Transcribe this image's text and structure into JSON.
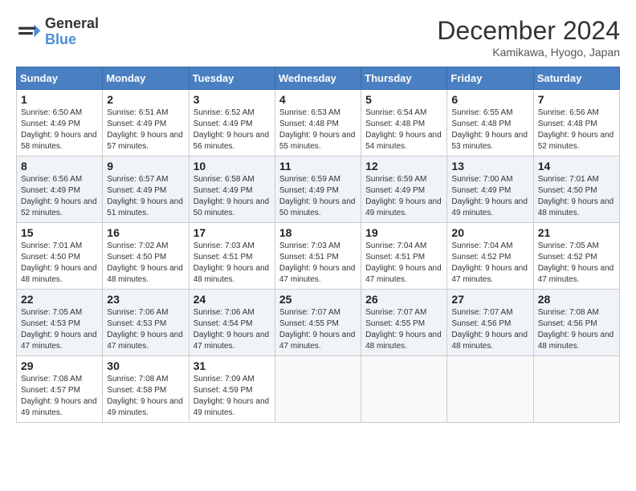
{
  "header": {
    "logo_line1": "General",
    "logo_line2": "Blue",
    "month": "December 2024",
    "location": "Kamikawa, Hyogo, Japan"
  },
  "weekdays": [
    "Sunday",
    "Monday",
    "Tuesday",
    "Wednesday",
    "Thursday",
    "Friday",
    "Saturday"
  ],
  "weeks": [
    [
      {
        "day": "1",
        "sunrise": "Sunrise: 6:50 AM",
        "sunset": "Sunset: 4:49 PM",
        "daylight": "Daylight: 9 hours and 58 minutes."
      },
      {
        "day": "2",
        "sunrise": "Sunrise: 6:51 AM",
        "sunset": "Sunset: 4:49 PM",
        "daylight": "Daylight: 9 hours and 57 minutes."
      },
      {
        "day": "3",
        "sunrise": "Sunrise: 6:52 AM",
        "sunset": "Sunset: 4:49 PM",
        "daylight": "Daylight: 9 hours and 56 minutes."
      },
      {
        "day": "4",
        "sunrise": "Sunrise: 6:53 AM",
        "sunset": "Sunset: 4:48 PM",
        "daylight": "Daylight: 9 hours and 55 minutes."
      },
      {
        "day": "5",
        "sunrise": "Sunrise: 6:54 AM",
        "sunset": "Sunset: 4:48 PM",
        "daylight": "Daylight: 9 hours and 54 minutes."
      },
      {
        "day": "6",
        "sunrise": "Sunrise: 6:55 AM",
        "sunset": "Sunset: 4:48 PM",
        "daylight": "Daylight: 9 hours and 53 minutes."
      },
      {
        "day": "7",
        "sunrise": "Sunrise: 6:56 AM",
        "sunset": "Sunset: 4:48 PM",
        "daylight": "Daylight: 9 hours and 52 minutes."
      }
    ],
    [
      {
        "day": "8",
        "sunrise": "Sunrise: 6:56 AM",
        "sunset": "Sunset: 4:49 PM",
        "daylight": "Daylight: 9 hours and 52 minutes."
      },
      {
        "day": "9",
        "sunrise": "Sunrise: 6:57 AM",
        "sunset": "Sunset: 4:49 PM",
        "daylight": "Daylight: 9 hours and 51 minutes."
      },
      {
        "day": "10",
        "sunrise": "Sunrise: 6:58 AM",
        "sunset": "Sunset: 4:49 PM",
        "daylight": "Daylight: 9 hours and 50 minutes."
      },
      {
        "day": "11",
        "sunrise": "Sunrise: 6:59 AM",
        "sunset": "Sunset: 4:49 PM",
        "daylight": "Daylight: 9 hours and 50 minutes."
      },
      {
        "day": "12",
        "sunrise": "Sunrise: 6:59 AM",
        "sunset": "Sunset: 4:49 PM",
        "daylight": "Daylight: 9 hours and 49 minutes."
      },
      {
        "day": "13",
        "sunrise": "Sunrise: 7:00 AM",
        "sunset": "Sunset: 4:49 PM",
        "daylight": "Daylight: 9 hours and 49 minutes."
      },
      {
        "day": "14",
        "sunrise": "Sunrise: 7:01 AM",
        "sunset": "Sunset: 4:50 PM",
        "daylight": "Daylight: 9 hours and 48 minutes."
      }
    ],
    [
      {
        "day": "15",
        "sunrise": "Sunrise: 7:01 AM",
        "sunset": "Sunset: 4:50 PM",
        "daylight": "Daylight: 9 hours and 48 minutes."
      },
      {
        "day": "16",
        "sunrise": "Sunrise: 7:02 AM",
        "sunset": "Sunset: 4:50 PM",
        "daylight": "Daylight: 9 hours and 48 minutes."
      },
      {
        "day": "17",
        "sunrise": "Sunrise: 7:03 AM",
        "sunset": "Sunset: 4:51 PM",
        "daylight": "Daylight: 9 hours and 48 minutes."
      },
      {
        "day": "18",
        "sunrise": "Sunrise: 7:03 AM",
        "sunset": "Sunset: 4:51 PM",
        "daylight": "Daylight: 9 hours and 47 minutes."
      },
      {
        "day": "19",
        "sunrise": "Sunrise: 7:04 AM",
        "sunset": "Sunset: 4:51 PM",
        "daylight": "Daylight: 9 hours and 47 minutes."
      },
      {
        "day": "20",
        "sunrise": "Sunrise: 7:04 AM",
        "sunset": "Sunset: 4:52 PM",
        "daylight": "Daylight: 9 hours and 47 minutes."
      },
      {
        "day": "21",
        "sunrise": "Sunrise: 7:05 AM",
        "sunset": "Sunset: 4:52 PM",
        "daylight": "Daylight: 9 hours and 47 minutes."
      }
    ],
    [
      {
        "day": "22",
        "sunrise": "Sunrise: 7:05 AM",
        "sunset": "Sunset: 4:53 PM",
        "daylight": "Daylight: 9 hours and 47 minutes."
      },
      {
        "day": "23",
        "sunrise": "Sunrise: 7:06 AM",
        "sunset": "Sunset: 4:53 PM",
        "daylight": "Daylight: 9 hours and 47 minutes."
      },
      {
        "day": "24",
        "sunrise": "Sunrise: 7:06 AM",
        "sunset": "Sunset: 4:54 PM",
        "daylight": "Daylight: 9 hours and 47 minutes."
      },
      {
        "day": "25",
        "sunrise": "Sunrise: 7:07 AM",
        "sunset": "Sunset: 4:55 PM",
        "daylight": "Daylight: 9 hours and 47 minutes."
      },
      {
        "day": "26",
        "sunrise": "Sunrise: 7:07 AM",
        "sunset": "Sunset: 4:55 PM",
        "daylight": "Daylight: 9 hours and 48 minutes."
      },
      {
        "day": "27",
        "sunrise": "Sunrise: 7:07 AM",
        "sunset": "Sunset: 4:56 PM",
        "daylight": "Daylight: 9 hours and 48 minutes."
      },
      {
        "day": "28",
        "sunrise": "Sunrise: 7:08 AM",
        "sunset": "Sunset: 4:56 PM",
        "daylight": "Daylight: 9 hours and 48 minutes."
      }
    ],
    [
      {
        "day": "29",
        "sunrise": "Sunrise: 7:08 AM",
        "sunset": "Sunset: 4:57 PM",
        "daylight": "Daylight: 9 hours and 49 minutes."
      },
      {
        "day": "30",
        "sunrise": "Sunrise: 7:08 AM",
        "sunset": "Sunset: 4:58 PM",
        "daylight": "Daylight: 9 hours and 49 minutes."
      },
      {
        "day": "31",
        "sunrise": "Sunrise: 7:09 AM",
        "sunset": "Sunset: 4:59 PM",
        "daylight": "Daylight: 9 hours and 49 minutes."
      },
      null,
      null,
      null,
      null
    ]
  ]
}
